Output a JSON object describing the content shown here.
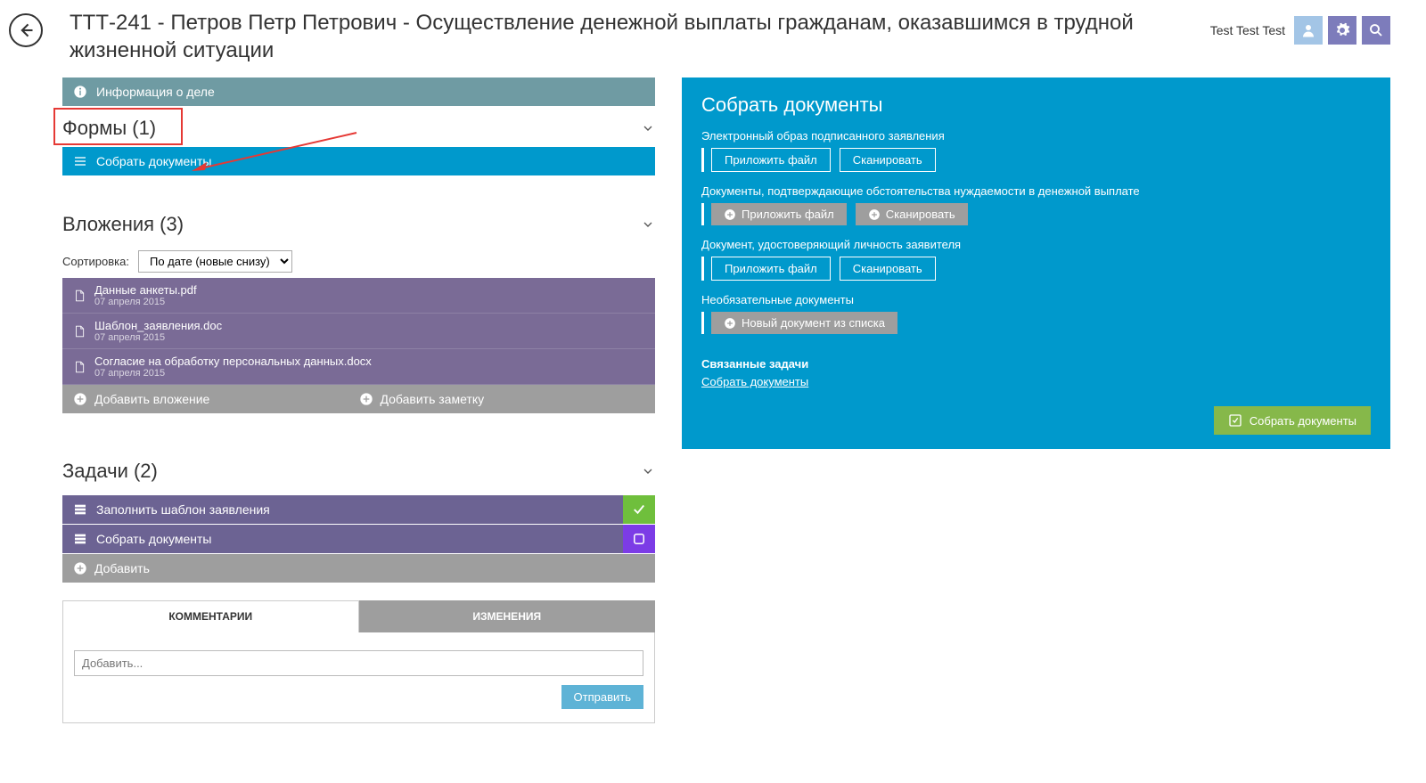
{
  "header": {
    "title": "ТТТ-241 -  Петров Петр  Петрович - Осуществление денежной выплаты гражданам, оказавшимся в трудной жизненной ситуации",
    "user": "Test Test Test"
  },
  "info_bar": "Информация о деле",
  "forms": {
    "title": "Формы (1)",
    "collect": "Собрать документы"
  },
  "attachments": {
    "title": "Вложения (3)",
    "sort_label": "Сортировка:",
    "sort_value": "По дате (новые снизу)",
    "items": [
      {
        "name": "Данные анкеты.pdf",
        "date": "07 апреля 2015"
      },
      {
        "name": "Шаблон_заявления.doc",
        "date": "07 апреля 2015"
      },
      {
        "name": "Согласие на обработку персональных данных.docx",
        "date": "07 апреля 2015"
      }
    ],
    "add_attachment": "Добавить вложение",
    "add_note": "Добавить заметку"
  },
  "tasks": {
    "title": "Задачи (2)",
    "items": [
      {
        "name": "Заполнить шаблон заявления",
        "status": "done"
      },
      {
        "name": "Собрать документы",
        "status": "pending"
      }
    ],
    "add": "Добавить"
  },
  "tabs": {
    "comments": "КОММЕНТАРИИ",
    "changes": "ИЗМЕНЕНИЯ",
    "placeholder": "Добавить...",
    "send": "Отправить"
  },
  "panel": {
    "title": "Собрать документы",
    "groups": [
      {
        "label": "Электронный образ подписанного заявления",
        "style": "outline",
        "buttons": [
          "Приложить файл",
          "Сканировать"
        ]
      },
      {
        "label": "Документы, подтверждающие обстоятельства нуждаемости в денежной выплате",
        "style": "solid",
        "buttons": [
          "Приложить файл",
          "Сканировать"
        ]
      },
      {
        "label": "Документ, удостоверяющий личность заявителя",
        "style": "outline",
        "buttons": [
          "Приложить файл",
          "Сканировать"
        ]
      },
      {
        "label": "Необязательные документы",
        "style": "solid",
        "buttons": [
          "Новый документ из списка"
        ]
      }
    ],
    "related_title": "Связанные задачи",
    "related_link": "Собрать документы",
    "submit": "Собрать документы"
  }
}
